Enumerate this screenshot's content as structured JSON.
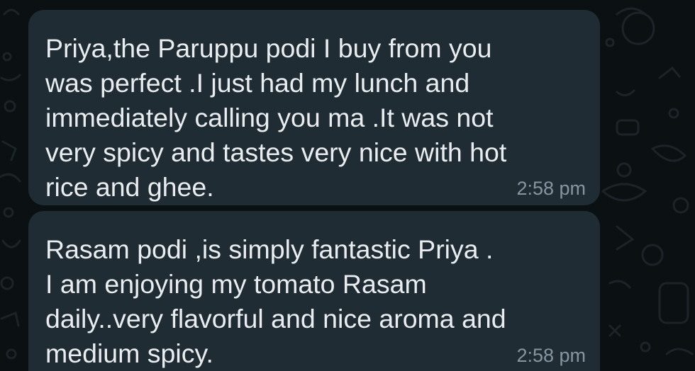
{
  "chat": {
    "background_color": "#0b1013",
    "bubble_color": "#1f2c33",
    "messages": [
      {
        "text": "Priya,the Paruppu podi I buy from you\nwas perfect .I just had my lunch and\nimmediately calling you ma .It was not\nvery spicy and tastes very nice with hot\nrice and ghee.",
        "time": "2:58 pm"
      },
      {
        "text": "Rasam podi ,is simply fantastic Priya .\nI am enjoying my tomato Rasam\ndaily..very flavorful and nice aroma and\nmedium spicy.",
        "time": "2:58 pm"
      }
    ]
  }
}
